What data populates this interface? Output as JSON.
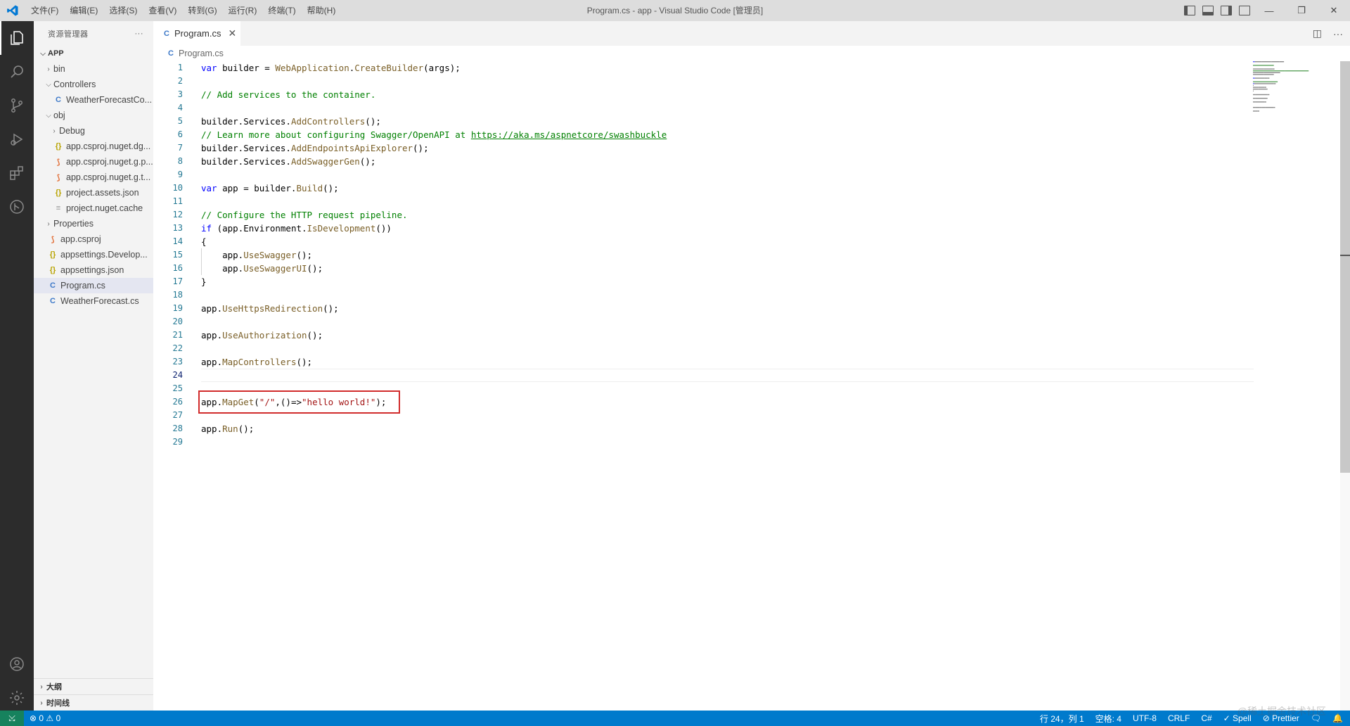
{
  "titlebar": {
    "menu": [
      "文件(F)",
      "编辑(E)",
      "选择(S)",
      "查看(V)",
      "转到(G)",
      "运行(R)",
      "终端(T)",
      "帮助(H)"
    ],
    "title": "Program.cs - app - Visual Studio Code [管理员]"
  },
  "activitybar": {
    "items": [
      "explorer-icon",
      "search-icon",
      "source-control-icon",
      "run-debug-icon",
      "extensions-icon",
      "remote-icon"
    ],
    "bottom": [
      "account-icon",
      "settings-gear-icon"
    ]
  },
  "sidebar": {
    "header": "资源管理器",
    "more": "···",
    "section": "APP",
    "tree": [
      {
        "label": "bin",
        "kind": "folder",
        "open": false,
        "depth": 1
      },
      {
        "label": "Controllers",
        "kind": "folder",
        "open": true,
        "depth": 1
      },
      {
        "label": "WeatherForecastCo...",
        "kind": "cs",
        "depth": 2
      },
      {
        "label": "obj",
        "kind": "folder",
        "open": true,
        "depth": 1
      },
      {
        "label": "Debug",
        "kind": "folder",
        "open": false,
        "depth": 2
      },
      {
        "label": "app.csproj.nuget.dg...",
        "kind": "json",
        "depth": 2
      },
      {
        "label": "app.csproj.nuget.g.p...",
        "kind": "rss",
        "depth": 2
      },
      {
        "label": "app.csproj.nuget.g.t...",
        "kind": "rss",
        "depth": 2
      },
      {
        "label": "project.assets.json",
        "kind": "json",
        "depth": 2
      },
      {
        "label": "project.nuget.cache",
        "kind": "cache",
        "depth": 2
      },
      {
        "label": "Properties",
        "kind": "folder",
        "open": false,
        "depth": 1
      },
      {
        "label": "app.csproj",
        "kind": "rss",
        "depth": 1
      },
      {
        "label": "appsettings.Develop...",
        "kind": "json",
        "depth": 1
      },
      {
        "label": "appsettings.json",
        "kind": "json",
        "depth": 1
      },
      {
        "label": "Program.cs",
        "kind": "cs",
        "depth": 1,
        "selected": true
      },
      {
        "label": "WeatherForecast.cs",
        "kind": "cs",
        "depth": 1
      }
    ],
    "bottom_panes": [
      "大纲",
      "时间线"
    ]
  },
  "editor": {
    "tab_label": "Program.cs",
    "breadcrumb": "Program.cs",
    "current_line": 24,
    "code": [
      [
        [
          "kw",
          "var"
        ],
        [
          "t",
          " builder = "
        ],
        [
          "fn",
          "WebApplication"
        ],
        [
          "t",
          "."
        ],
        [
          "fn",
          "CreateBuilder"
        ],
        [
          "t",
          "(args);"
        ]
      ],
      [],
      [
        [
          "cm",
          "// Add services to the container."
        ]
      ],
      [],
      [
        [
          "t",
          "builder.Services."
        ],
        [
          "fn",
          "AddControllers"
        ],
        [
          "t",
          "();"
        ]
      ],
      [
        [
          "cm",
          "// Learn more about configuring Swagger/OpenAPI at "
        ],
        [
          "link",
          "https://aka.ms/aspnetcore/swashbuckle"
        ]
      ],
      [
        [
          "t",
          "builder.Services."
        ],
        [
          "fn",
          "AddEndpointsApiExplorer"
        ],
        [
          "t",
          "();"
        ]
      ],
      [
        [
          "t",
          "builder.Services."
        ],
        [
          "fn",
          "AddSwaggerGen"
        ],
        [
          "t",
          "();"
        ]
      ],
      [],
      [
        [
          "kw",
          "var"
        ],
        [
          "t",
          " app = builder."
        ],
        [
          "fn",
          "Build"
        ],
        [
          "t",
          "();"
        ]
      ],
      [],
      [
        [
          "cm",
          "// Configure the HTTP request pipeline."
        ]
      ],
      [
        [
          "kw",
          "if"
        ],
        [
          "t",
          " (app.Environment."
        ],
        [
          "fn",
          "IsDevelopment"
        ],
        [
          "t",
          "())"
        ]
      ],
      [
        [
          "t",
          "{"
        ]
      ],
      [
        [
          "t",
          "    app."
        ],
        [
          "fn",
          "UseSwagger"
        ],
        [
          "t",
          "();"
        ]
      ],
      [
        [
          "t",
          "    app."
        ],
        [
          "fn",
          "UseSwaggerUI"
        ],
        [
          "t",
          "();"
        ]
      ],
      [
        [
          "t",
          "}"
        ]
      ],
      [],
      [
        [
          "t",
          "app."
        ],
        [
          "fn",
          "UseHttpsRedirection"
        ],
        [
          "t",
          "();"
        ]
      ],
      [],
      [
        [
          "t",
          "app."
        ],
        [
          "fn",
          "UseAuthorization"
        ],
        [
          "t",
          "();"
        ]
      ],
      [],
      [
        [
          "t",
          "app."
        ],
        [
          "fn",
          "MapControllers"
        ],
        [
          "t",
          "();"
        ]
      ],
      [],
      [],
      [
        [
          "t",
          "app."
        ],
        [
          "fn",
          "MapGet"
        ],
        [
          "t",
          "("
        ],
        [
          "str",
          "\"/\""
        ],
        [
          "t",
          ",()=>"
        ],
        [
          "str",
          "\"hello world!\""
        ],
        [
          "t",
          ");"
        ]
      ],
      [],
      [
        [
          "t",
          "app."
        ],
        [
          "fn",
          "Run"
        ],
        [
          "t",
          "();"
        ]
      ],
      []
    ]
  },
  "statusbar": {
    "remote": "⤩",
    "problems": "⊗ 0 ⚠ 0",
    "position": "行 24，列 1",
    "spaces": "空格: 4",
    "encoding": "UTF-8",
    "eol": "CRLF",
    "language": "C#",
    "spell": "✓ Spell",
    "prettier": "⊘ Prettier",
    "feedback": "🗨",
    "bell": "🔔"
  },
  "watermark": "@稀土掘金技术社区",
  "colors": {
    "accent": "#007acc",
    "highlight": "#d12b2b",
    "activitybar": "#2c2c2c"
  }
}
